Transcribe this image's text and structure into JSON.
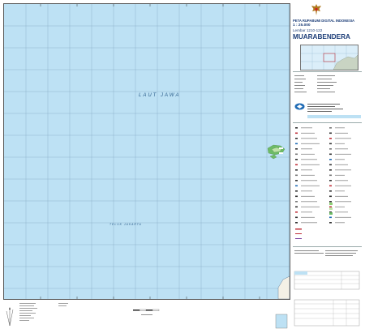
{
  "map": {
    "sea_main": "LAUT JAWA",
    "sea_bay": "TELUK JAKARTA",
    "colors": {
      "sea": "#bde1f4",
      "grid": "#7fa3bf",
      "land": "#bfe3a8",
      "coral": "#6dbb66",
      "title_blue": "#1d3e78",
      "red_band": "#c0303a"
    }
  },
  "legend_panel": {
    "title": "PETA RUPABUMI DIGITAL INDONESIA",
    "scale": "1 : 25.000",
    "sheet_number": "Lembar 1210-122",
    "sheet_name": "MUARABENDERA"
  }
}
